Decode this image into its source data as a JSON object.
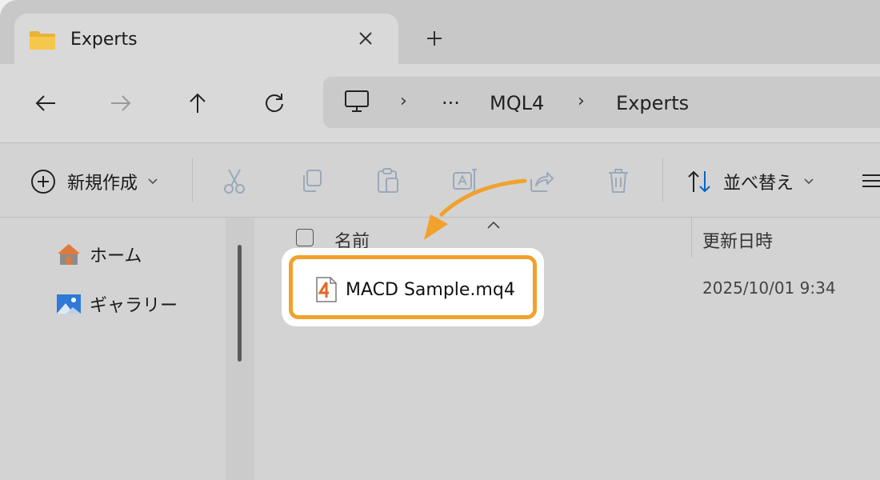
{
  "tab": {
    "title": "Experts",
    "close_glyph": "✕",
    "new_tab_glyph": "+"
  },
  "address": {
    "ellipsis": "···",
    "crumbs": [
      "MQL4",
      "Experts"
    ],
    "separator": "›"
  },
  "toolbar": {
    "new_label": "新規作成",
    "sort_label": "並べ替え"
  },
  "sidebar": {
    "items": [
      {
        "label": "ホーム",
        "icon": "home-icon"
      },
      {
        "label": "ギャラリー",
        "icon": "gallery-icon"
      }
    ]
  },
  "columns": {
    "name": "名前",
    "modified": "更新日時"
  },
  "files": [
    {
      "name": "MACD Sample.mq4",
      "modified": "2025/10/01 9:34",
      "icon": "mq4-file-icon"
    }
  ],
  "colors": {
    "highlight": "#f1a12c",
    "folder": "#e8b33a",
    "accent": "#0067c0"
  }
}
